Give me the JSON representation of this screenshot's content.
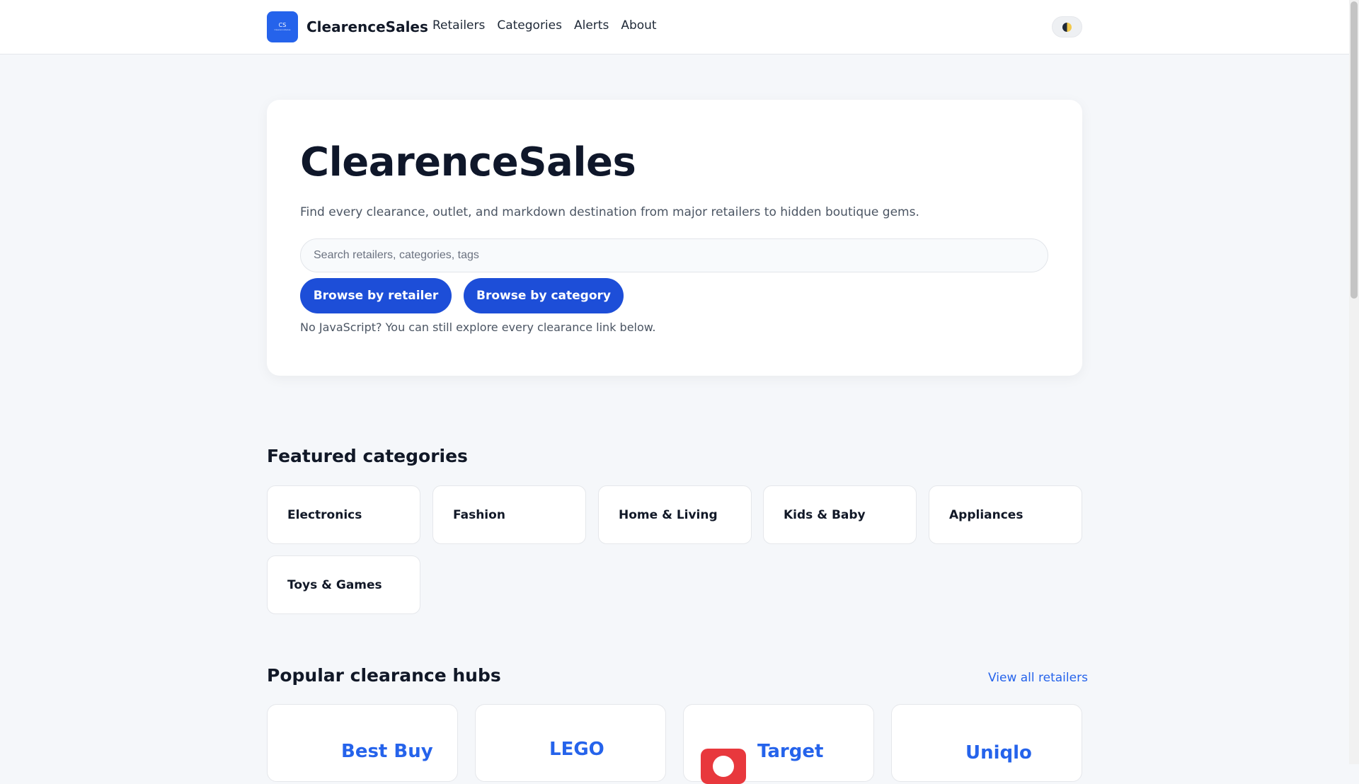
{
  "header": {
    "logo_text": "CS",
    "logo_subtext": "ClearenceSales",
    "brand": "ClearenceSales",
    "nav": [
      "Retailers",
      "Categories",
      "Alerts",
      "About"
    ],
    "theme_toggle_icon": "half-moon-icon"
  },
  "hero": {
    "title": "ClearenceSales",
    "description": "Find every clearance, outlet, and markdown destination from major retailers to hidden boutique gems.",
    "search_placeholder": "Search retailers, categories, tags",
    "search_value": "",
    "browse_retailer": "Browse by retailer",
    "browse_category": "Browse by category",
    "nojs_note": "No JavaScript? You can still explore every clearance link below."
  },
  "featured": {
    "title": "Featured categories",
    "categories": [
      "Electronics",
      "Fashion",
      "Home & Living",
      "Kids & Baby",
      "Appliances",
      "Toys & Games"
    ]
  },
  "hubs": {
    "title": "Popular clearance hubs",
    "view_all": "View all retailers",
    "retailers": [
      "Best Buy",
      "LEGO",
      "Target",
      "Uniqlo"
    ]
  },
  "colors": {
    "accent": "#2563eb",
    "button": "#1d4ed8",
    "target_red": "#e8383d",
    "background": "#f5f7fa"
  }
}
